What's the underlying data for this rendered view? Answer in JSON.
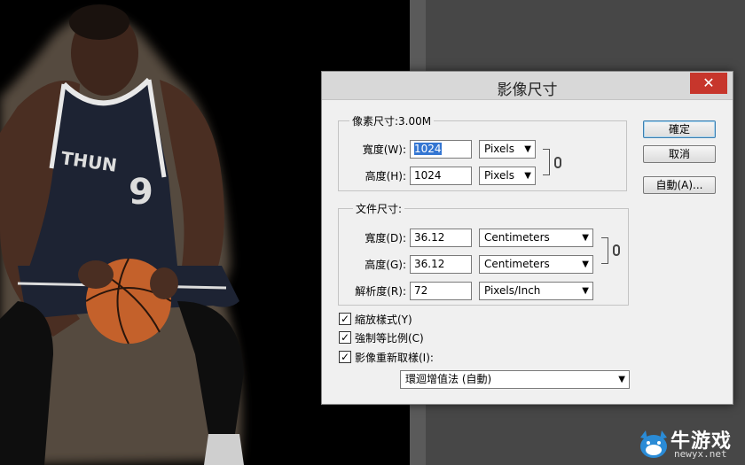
{
  "dialog": {
    "title": "影像尺寸",
    "close_glyph": "✕"
  },
  "pixel_dims": {
    "legend": "像素尺寸:3.00M",
    "width_label": "寬度(W):",
    "width_value": "1024",
    "width_unit": "Pixels",
    "height_label": "高度(H):",
    "height_value": "1024",
    "height_unit": "Pixels"
  },
  "doc_size": {
    "legend": "文件尺寸:",
    "width_label": "寬度(D):",
    "width_value": "36.12",
    "width_unit": "Centimeters",
    "height_label": "高度(G):",
    "height_value": "36.12",
    "height_unit": "Centimeters",
    "res_label": "解析度(R):",
    "res_value": "72",
    "res_unit": "Pixels/Inch"
  },
  "buttons": {
    "ok": "確定",
    "cancel": "取消",
    "auto": "自動(A)..."
  },
  "options": {
    "scale_styles": "縮放樣式(Y)",
    "constrain": "強制等比例(C)",
    "resample": "影像重新取樣(I):",
    "resample_method": "環迴增值法 (自動)",
    "check_glyph": "✓"
  },
  "watermark": {
    "brand": "牛游戏",
    "site": "newyx.net"
  },
  "photo": {
    "jersey_text": "THUN",
    "jersey_number": "9"
  },
  "colors": {
    "close": "#c7362c",
    "selection": "#3476d2",
    "jersey": "#1d2333"
  }
}
